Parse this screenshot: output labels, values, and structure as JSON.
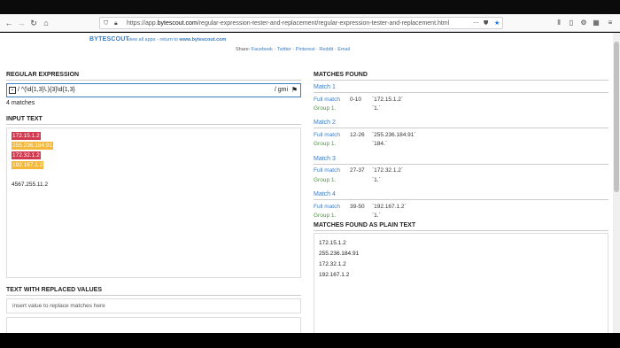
{
  "browser": {
    "url_prefix": "https://app.",
    "url_domain": "bytescout.com",
    "url_path": "/regular-expression-tester-and-replacement/regular-expression-tester-and-replacement.html",
    "icons": [
      "back-icon",
      "forward-icon",
      "reload-icon",
      "home-icon",
      "shield-icon",
      "lock-icon",
      "page-actions-icon",
      "pocket-icon",
      "bookmark-star-icon",
      "library-icon",
      "sidebar-icon",
      "extension-icon",
      "account-icon",
      "menu-icon"
    ]
  },
  "header": {
    "logo_a": "BYTE",
    "logo_b": "SCOUT",
    "view_all": "view all apps",
    "return_text": " - return to ",
    "return_link": "www.bytescout.com",
    "share_label": "Share:",
    "share_links": [
      "Facebook",
      "Twitter",
      "Pinterest",
      "Reddit",
      "Email"
    ]
  },
  "regex": {
    "title": "REGULAR EXPRESSION",
    "prefix": "/",
    "pattern": "^(\\d{1,3}\\.){3}\\d{1,3}",
    "flags": "/ gmi",
    "count": "4 matches"
  },
  "input": {
    "title": "INPUT TEXT",
    "highlighted": [
      "172.15.1.2",
      "255.236.184.91",
      "172.32.1.2",
      "192.167.1.2"
    ],
    "plain": "4567.255.11.2"
  },
  "replace": {
    "title": "TEXT WITH REPLACED VALUES",
    "placeholder": "insert value to replace matches here"
  },
  "matches": {
    "title": "MATCHES FOUND",
    "full_label": "Full match",
    "group_label": "Group 1.",
    "items": [
      {
        "head": "Match 1",
        "range": "0-10",
        "full": "`172.15.1.2`",
        "group": "`1.`"
      },
      {
        "head": "Match 2",
        "range": "12-26",
        "full": "`255.236.184.91`",
        "group": "`184.`"
      },
      {
        "head": "Match 3",
        "range": "27-37",
        "full": "`172.32.1.2`",
        "group": "`1.`"
      },
      {
        "head": "Match 4",
        "range": "39-50",
        "full": "`192.167.1.2`",
        "group": "`1.`"
      }
    ]
  },
  "plain": {
    "title": "MATCHES FOUND AS PLAIN TEXT",
    "items": [
      "172.15.1.2",
      "255.236.184.91",
      "172.32.1.2",
      "192.167.1.2"
    ]
  }
}
